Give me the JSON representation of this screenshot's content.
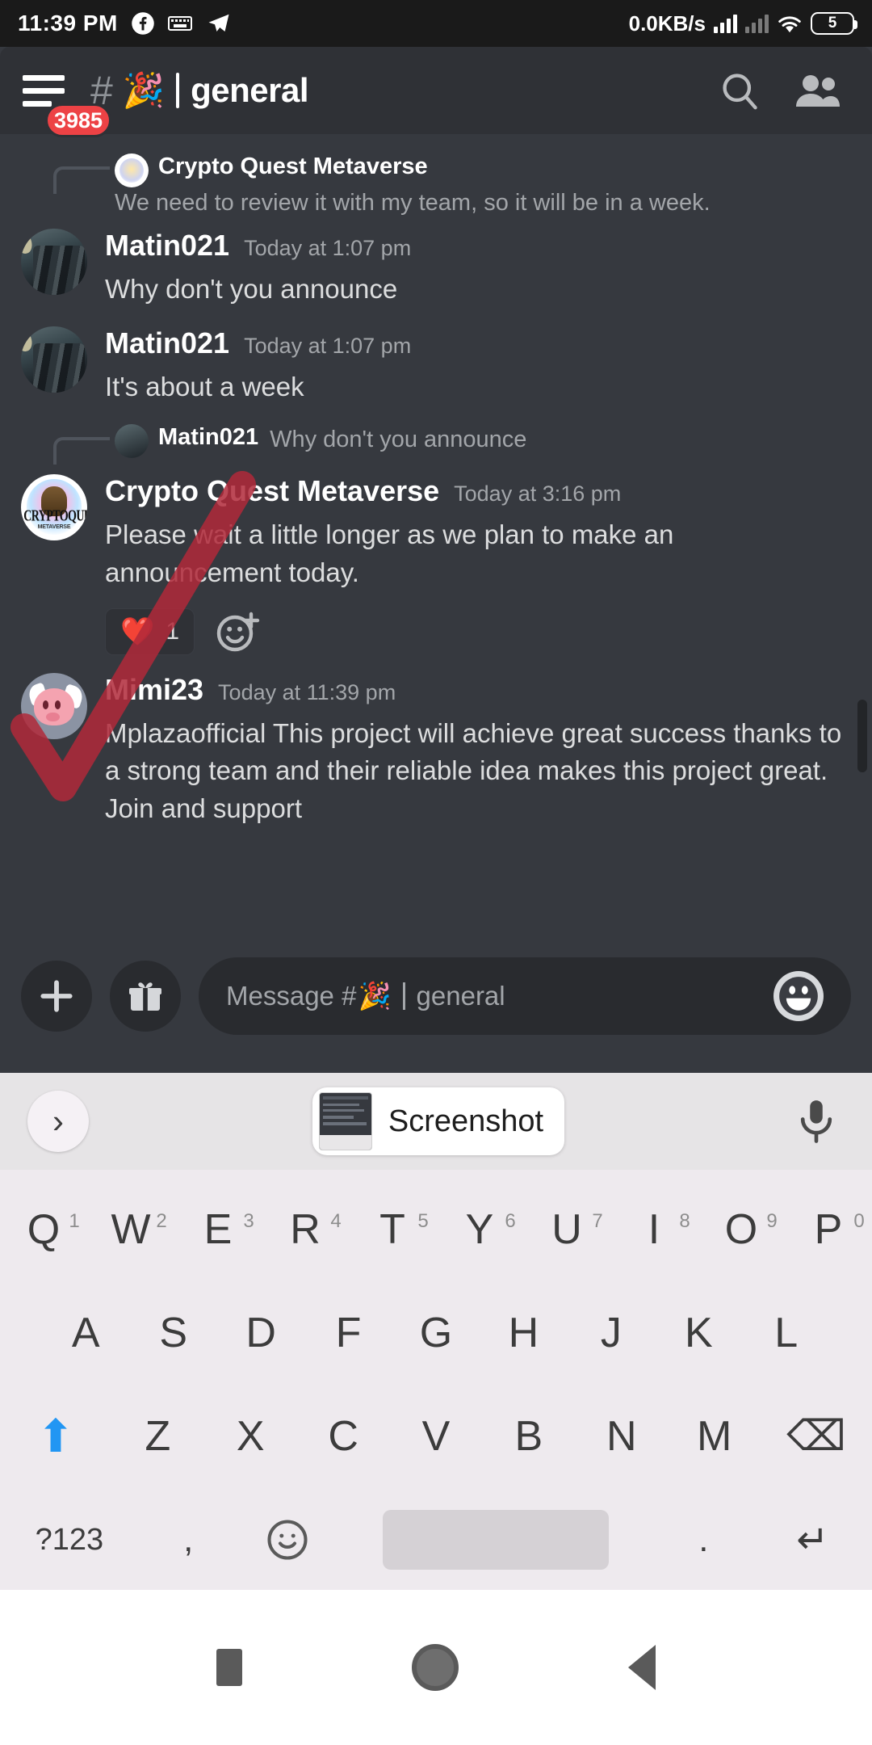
{
  "status_bar": {
    "time": "11:39 PM",
    "network_speed": "0.0KB/s",
    "battery_level": "5",
    "icons": [
      "facebook-icon",
      "keyboard-icon",
      "telegram-icon",
      "signal-bars-icon",
      "signal-bars-off-icon",
      "wifi-icon",
      "battery-icon"
    ]
  },
  "header": {
    "unread_badge": "3985",
    "hash": "#",
    "channel_emoji": "🎉",
    "channel_name": "general",
    "search_icon": "search-icon",
    "members_icon": "members-icon"
  },
  "messages": [
    {
      "type": "reply_context",
      "author": "Crypto Quest Metaverse",
      "preview": "We need to review it with my team, so it will be in a week."
    },
    {
      "type": "message",
      "author": "Matin021",
      "timestamp": "Today at 1:07 pm",
      "text": "Why don't you announce"
    },
    {
      "type": "message",
      "author": "Matin021",
      "timestamp": "Today at 1:07 pm",
      "text": "It's about a week"
    },
    {
      "type": "reply_context",
      "author": "Matin021",
      "preview": "Why don't you announce"
    },
    {
      "type": "message",
      "author": "Crypto Quest Metaverse",
      "timestamp": "Today at 3:16 pm",
      "text": "Please wait a little longer as we plan to make an announcement today.",
      "reaction": {
        "emoji": "❤️",
        "count": "1"
      }
    },
    {
      "type": "message",
      "author": "Mimi23",
      "timestamp": "Today at 11:39 pm",
      "text": "Mplazaofficial This project will achieve great success thanks to a strong team and their reliable idea makes this project great. Join and support"
    }
  ],
  "composer": {
    "add_button": "+",
    "gift_button": "gift-icon",
    "placeholder_prefix": "Message #",
    "placeholder_emoji": "🎉",
    "placeholder_channel": "general",
    "emoji_button": "emoji-icon"
  },
  "keyboard": {
    "suggestion_arrow": "›",
    "clipboard_chip_label": "Screenshot",
    "mic_icon": "microphone-icon",
    "row1": [
      {
        "key": "Q",
        "num": "1"
      },
      {
        "key": "W",
        "num": "2"
      },
      {
        "key": "E",
        "num": "3"
      },
      {
        "key": "R",
        "num": "4"
      },
      {
        "key": "T",
        "num": "5"
      },
      {
        "key": "Y",
        "num": "6"
      },
      {
        "key": "U",
        "num": "7"
      },
      {
        "key": "I",
        "num": "8"
      },
      {
        "key": "O",
        "num": "9"
      },
      {
        "key": "P",
        "num": "0"
      }
    ],
    "row2": [
      "A",
      "S",
      "D",
      "F",
      "G",
      "H",
      "J",
      "K",
      "L"
    ],
    "row3_letters": [
      "Z",
      "X",
      "C",
      "V",
      "B",
      "N",
      "M"
    ],
    "shift_key": "⬆",
    "backspace_key": "⌫",
    "symbols_key": "?123",
    "comma_key": ",",
    "emoji_key": "☺",
    "space_key": "",
    "period_key": ".",
    "enter_key": "↵"
  },
  "nav_bar": {
    "recents": "recents-square-icon",
    "home": "home-circle-icon",
    "back": "back-triangle-icon"
  },
  "annotation": {
    "type": "red-check-mark",
    "color": "#b0293a"
  },
  "colors": {
    "discord_bg": "#36393f",
    "discord_header": "#2f3136",
    "accent_red": "#ed4245",
    "text_primary": "#ffffff",
    "text_muted": "#a3a6aa",
    "keyboard_bg": "#eeeaee"
  }
}
